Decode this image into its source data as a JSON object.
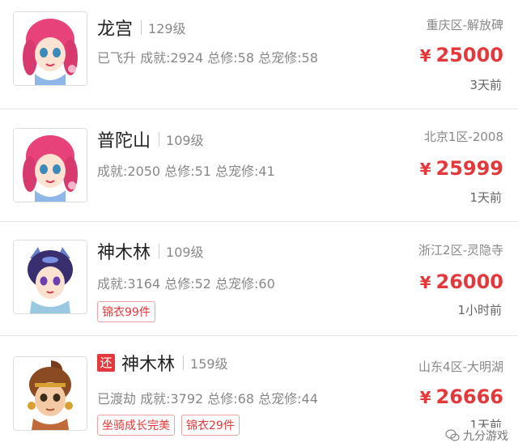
{
  "listings": [
    {
      "school": "龙宫",
      "level": "129级",
      "stats": "已飞升 成就:2924 总修:58 总宠修:58",
      "server": "重庆区-解放碑",
      "price_symbol": "¥",
      "price": "25000",
      "time": "3天前",
      "tags": []
    },
    {
      "school": "普陀山",
      "level": "109级",
      "stats": "成就:2050 总修:51 总宠修:41",
      "server": "北京1区-2008",
      "price_symbol": "¥",
      "price": "25999",
      "time": "1天前",
      "tags": []
    },
    {
      "school": "神木林",
      "level": "109级",
      "stats": "成就:3164 总修:52 总宠修:60",
      "server": "浙江2区-灵隐寺",
      "price_symbol": "¥",
      "price": "26000",
      "time": "1小时前",
      "tags": [
        "锦衣99件"
      ]
    },
    {
      "return_badge": "还",
      "school": "神木林",
      "level": "159级",
      "stats": "已渡劫 成就:3792 总修:68 总宠修:44",
      "server": "山东4区-大明湖",
      "price_symbol": "¥",
      "price": "26666",
      "time": "1天前",
      "tags": [
        "坐骑成长完美",
        "锦衣29件"
      ]
    }
  ],
  "watermark": {
    "text": "九分游戏",
    "icon": "wechat-icon"
  },
  "colors": {
    "accent": "#e4393c",
    "muted": "#888888",
    "divider": "#e8e8e8"
  }
}
